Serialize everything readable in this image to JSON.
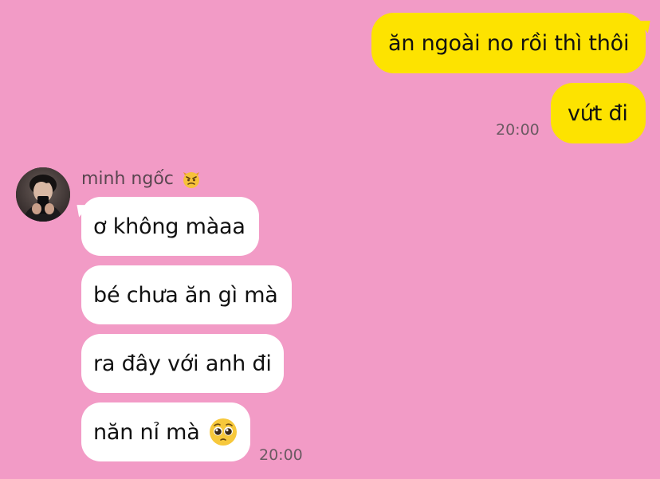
{
  "colors": {
    "background": "#f29bc6",
    "outgoing_bubble": "#fde300",
    "incoming_bubble": "#ffffff"
  },
  "outgoing": {
    "messages": [
      "ăn ngoài no rồi thì thôi",
      "vứt đi"
    ],
    "time": "20:00"
  },
  "incoming": {
    "sender": "minh ngốc",
    "sender_emoji": "devil-face-icon",
    "messages": [
      "ơ không màaa",
      "bé chưa ăn gì mà",
      "ra đây với anh đi",
      "năn nỉ mà"
    ],
    "last_emoji": "pleading-face-icon",
    "time": "20:00"
  }
}
